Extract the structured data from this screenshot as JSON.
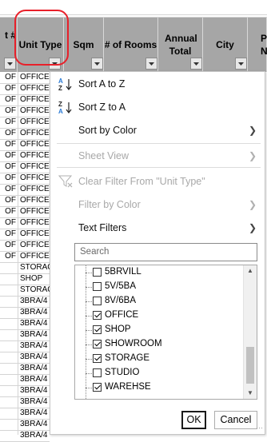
{
  "columns": [
    {
      "label": "t #"
    },
    {
      "label": "Unit Type"
    },
    {
      "label": "Sqm"
    },
    {
      "label": "# of Rooms"
    },
    {
      "label": "Annual Total"
    },
    {
      "label": "City"
    },
    {
      "label": "P Nu"
    }
  ],
  "rows": [
    {
      "a": "OF",
      "b": "OFFICE"
    },
    {
      "a": "OF",
      "b": "OFFICE"
    },
    {
      "a": "OF",
      "b": "OFFICE"
    },
    {
      "a": "OF",
      "b": "OFFICE"
    },
    {
      "a": "OF",
      "b": "OFFICE"
    },
    {
      "a": "OF",
      "b": "OFFICE"
    },
    {
      "a": "OF",
      "b": "OFFICE"
    },
    {
      "a": "OF",
      "b": "OFFICE"
    },
    {
      "a": "OF",
      "b": "OFFICE"
    },
    {
      "a": "OF",
      "b": "OFFICE"
    },
    {
      "a": "OF",
      "b": "OFFICE"
    },
    {
      "a": "OF",
      "b": "OFFICE"
    },
    {
      "a": "OF",
      "b": "OFFICE"
    },
    {
      "a": "OF",
      "b": "OFFICE"
    },
    {
      "a": "OF",
      "b": "OFFICE"
    },
    {
      "a": "OF",
      "b": "OFFICE"
    },
    {
      "a": "OF",
      "b": "OFFICE"
    },
    {
      "a": "",
      "b": "STORAG"
    },
    {
      "a": "",
      "b": "SHOP"
    },
    {
      "a": "",
      "b": "STORAG"
    },
    {
      "a": "",
      "b": "3BRA/4"
    },
    {
      "a": "",
      "b": "3BRA/4"
    },
    {
      "a": "",
      "b": "3BRA/4"
    },
    {
      "a": "",
      "b": "3BRA/4"
    },
    {
      "a": "",
      "b": "3BRA/4"
    },
    {
      "a": "",
      "b": "3BRA/4"
    },
    {
      "a": "",
      "b": "3BRA/4"
    },
    {
      "a": "",
      "b": "3BRA/4"
    },
    {
      "a": "",
      "b": "3BRA/4"
    },
    {
      "a": "",
      "b": "3BRA/4"
    },
    {
      "a": "",
      "b": "3BRA/4"
    },
    {
      "a": "",
      "b": "3BRA/4"
    },
    {
      "a": "",
      "b": "3BRA/4"
    }
  ],
  "menu": {
    "sort_az": "Sort A to Z",
    "sort_za": "Sort Z to A",
    "sort_color": "Sort by Color",
    "sheet_view": "Sheet View",
    "clear_filter": "Clear Filter From \"Unit Type\"",
    "filter_color": "Filter by Color",
    "text_filters": "Text Filters",
    "search_placeholder": "Search",
    "ok": "OK",
    "cancel": "Cancel"
  },
  "filter_values": [
    {
      "label": "5BRVILL",
      "checked": false
    },
    {
      "label": "5V/5BA",
      "checked": false
    },
    {
      "label": "8V/6BA",
      "checked": false
    },
    {
      "label": "OFFICE",
      "checked": true
    },
    {
      "label": "SHOP",
      "checked": true
    },
    {
      "label": "SHOWROOM",
      "checked": true
    },
    {
      "label": "STORAGE",
      "checked": true
    },
    {
      "label": "STUDIO",
      "checked": false
    },
    {
      "label": "WAREHSE",
      "checked": true
    }
  ],
  "colors": {
    "header_bg": "#a6a6a6",
    "highlight": "#e8202a",
    "grid": "#d4d4d4"
  }
}
